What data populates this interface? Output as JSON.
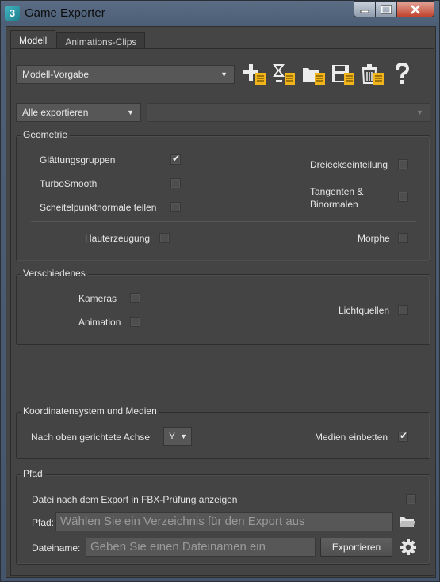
{
  "window": {
    "title": "Game Exporter",
    "app_icon_glyph": "3",
    "icons": [
      "minimize-icon",
      "maximize-icon",
      "close-icon"
    ]
  },
  "tabs": [
    {
      "label": "Modell",
      "active": true
    },
    {
      "label": "Animations-Clips",
      "active": false
    }
  ],
  "preset": {
    "value": "Modell-Vorgabe"
  },
  "toolbar": {
    "icons": [
      "add-preset-icon",
      "edit-preset-icon",
      "folder-preset-icon",
      "save-preset-icon",
      "delete-preset-icon",
      "help-icon"
    ],
    "accent": "#f2b41b"
  },
  "export_mode": {
    "value": "Alle exportieren"
  },
  "export_selection": {
    "value": ""
  },
  "geometrie": {
    "title": "Geometrie",
    "glaettung": {
      "label": "Glättungsgruppen",
      "checked": true
    },
    "turbosmooth": {
      "label": "TurboSmooth",
      "checked": false
    },
    "scheitel": {
      "label": "Scheitelpunktnormale teilen",
      "checked": false
    },
    "dreieck": {
      "label": "Dreieckseinteilung",
      "checked": false
    },
    "tangenten": {
      "label": "Tangenten &",
      "label2": "Binormalen",
      "checked": false
    },
    "haut": {
      "label": "Hauterzeugung",
      "checked": false
    },
    "morphe": {
      "label": "Morphe",
      "checked": false
    }
  },
  "verschiedenes": {
    "title": "Verschiedenes",
    "kameras": {
      "label": "Kameras",
      "checked": false
    },
    "animation": {
      "label": "Animation",
      "checked": false
    },
    "licht": {
      "label": "Lichtquellen",
      "checked": false
    }
  },
  "koordinaten": {
    "title": "Koordinatensystem und Medien",
    "achse_label": "Nach oben gerichtete Achse",
    "achse_value": "Y",
    "medien": {
      "label": "Medien einbetten",
      "checked": true
    }
  },
  "pfad": {
    "title": "Pfad",
    "fbx": {
      "label": "Datei nach dem Export in FBX-Prüfung anzeigen",
      "checked": false
    },
    "pfad_label": "Pfad:",
    "pfad_placeholder": "Wählen Sie ein Verzeichnis für den Export aus",
    "datei_label": "Dateiname:",
    "datei_placeholder": "Geben Sie einen Dateinamen ein",
    "export_button": "Exportieren",
    "icons": [
      "browse-folder-icon",
      "settings-gear-icon"
    ]
  }
}
